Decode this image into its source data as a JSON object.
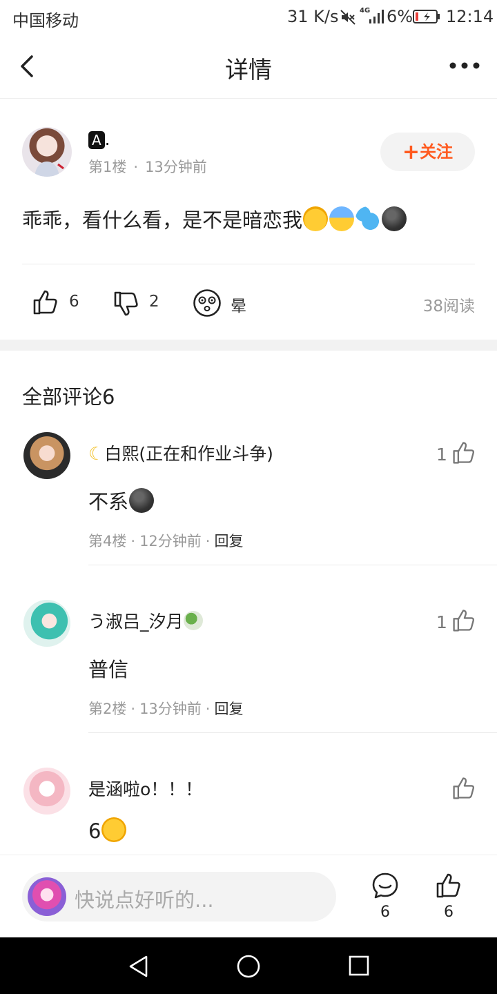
{
  "status_bar": {
    "carrier": "中国移动",
    "speed": "31 K/s",
    "network": "4G",
    "battery": "6%",
    "time": "12:14"
  },
  "nav": {
    "title": "详情"
  },
  "post": {
    "username": "A.",
    "floor": "第1楼",
    "time": "13分钟前",
    "follow_label": "关注",
    "content": "乖乖，看什么看，是不是暗恋我",
    "likes": "6",
    "dislikes": "2",
    "mood": "晕",
    "reads": "38阅读"
  },
  "comments": {
    "title": "全部评论6",
    "reply_label": "回复",
    "items": [
      {
        "name": "白熙(正在和作业斗争)",
        "text": "不系",
        "floor": "第4楼",
        "time": "12分钟前",
        "likes": "1"
      },
      {
        "name": "う淑吕_汐月",
        "text": "普信",
        "floor": "第2楼",
        "time": "13分钟前",
        "likes": "1"
      },
      {
        "name": "是涵啦o！！！",
        "text": "6",
        "floor": "",
        "time": "",
        "likes": ""
      }
    ]
  },
  "bottom_bar": {
    "input_placeholder": "快说点好听的...",
    "comment_count": "6",
    "like_count": "6"
  },
  "colors": {
    "accent": "#ff5a1f",
    "follow_bg": "#f3f3f3",
    "meta_text": "#9a9a9a",
    "divider": "#e9e9e9"
  }
}
